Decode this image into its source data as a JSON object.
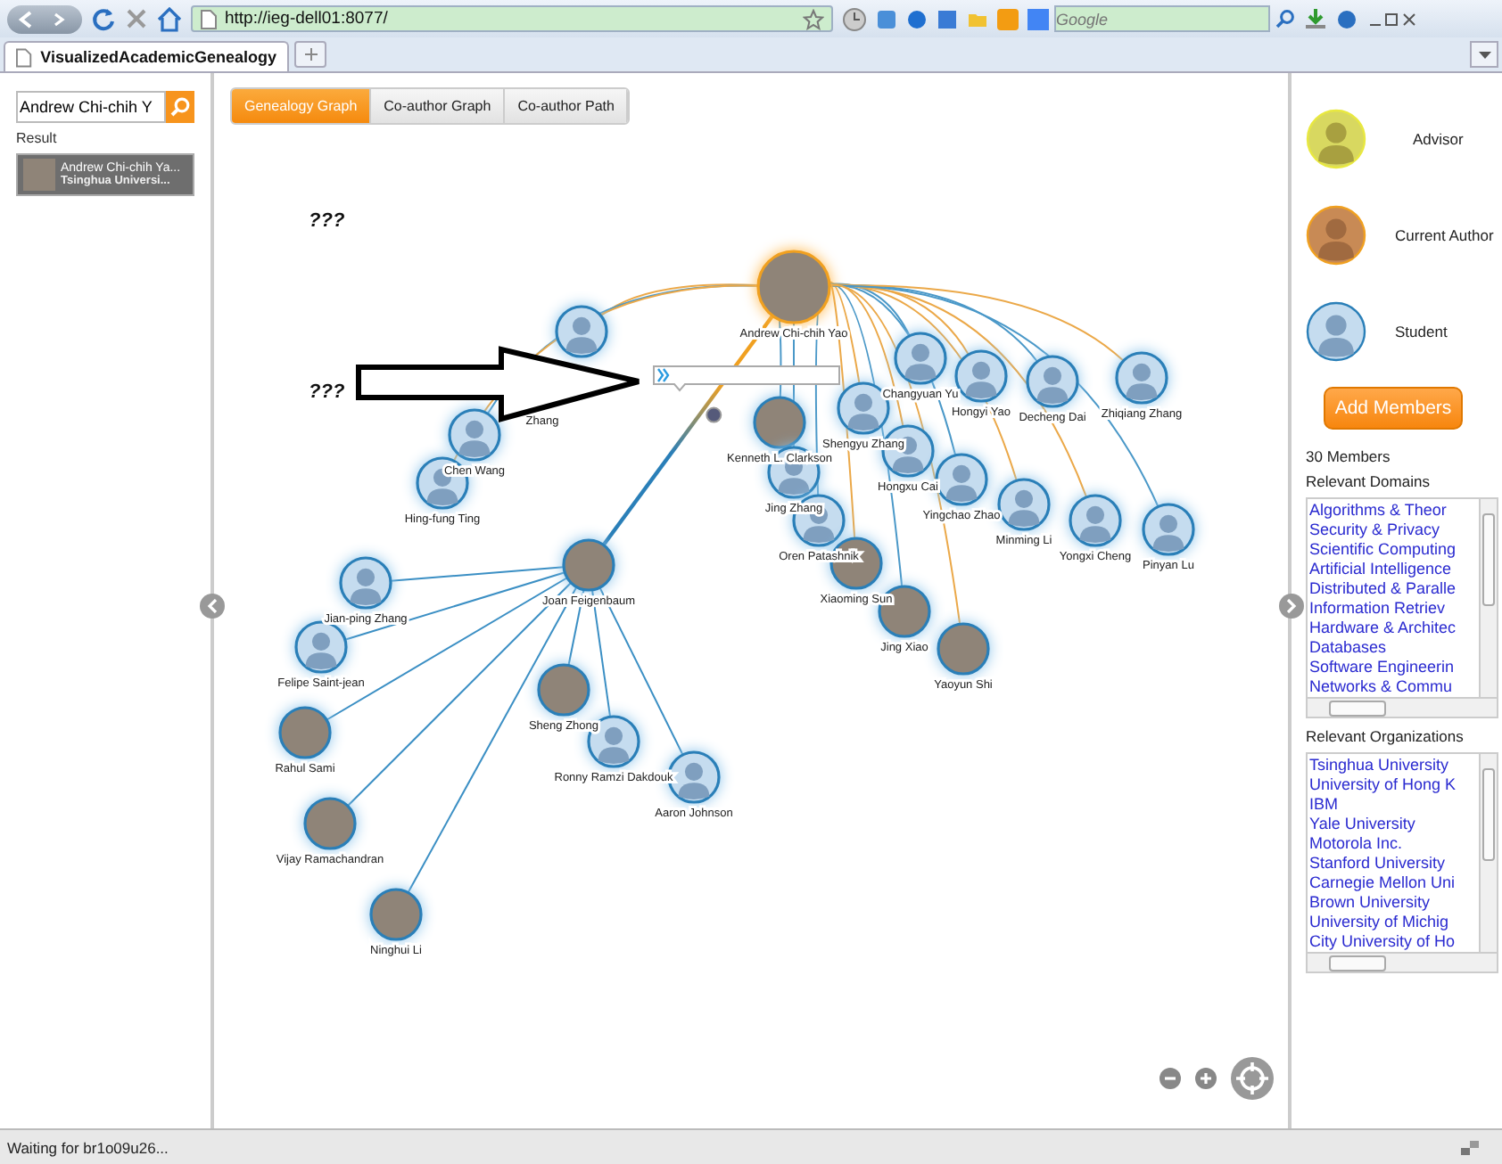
{
  "browser": {
    "url": "http://ieg-dell01:8077/",
    "search_placeholder": "Google",
    "tab_title": "VisualizedAcademicGenealogy"
  },
  "search": {
    "value": "Andrew Chi-chih Y",
    "result_label": "Result",
    "results": [
      {
        "name": "Andrew Chi-chih Ya...",
        "affiliation": "Tsinghua Universi...",
        "selected": true
      }
    ]
  },
  "view_tabs": [
    {
      "label": "Genealogy Graph",
      "selected": true
    },
    {
      "label": "Co-author Graph",
      "selected": false
    },
    {
      "label": "Co-author Path",
      "selected": false
    }
  ],
  "graph": {
    "annotations": [
      "???",
      "???"
    ],
    "nodes": [
      {
        "name": "Andrew Chi-chih Yao",
        "photo": true,
        "kind": "current"
      },
      {
        "name": "Zhang",
        "photo": false,
        "kind": "student"
      },
      {
        "name": "Chen Wang",
        "photo": false,
        "kind": "student"
      },
      {
        "name": "Hing-fung Ting",
        "photo": false,
        "kind": "student"
      },
      {
        "name": "Kenneth L. Clarkson",
        "photo": true,
        "kind": "student"
      },
      {
        "name": "Shengyu Zhang",
        "photo": false,
        "kind": "student"
      },
      {
        "name": "Changyuan Yu",
        "photo": false,
        "kind": "student"
      },
      {
        "name": "Hongyi Yao",
        "photo": false,
        "kind": "student"
      },
      {
        "name": "Decheng Dai",
        "photo": false,
        "kind": "student"
      },
      {
        "name": "Zhiqiang Zhang",
        "photo": false,
        "kind": "student"
      },
      {
        "name": "Jing Zhang",
        "photo": false,
        "kind": "student"
      },
      {
        "name": "Hongxu Cai",
        "photo": false,
        "kind": "student"
      },
      {
        "name": "Yingchao Zhao",
        "photo": false,
        "kind": "student"
      },
      {
        "name": "Minming Li",
        "photo": false,
        "kind": "student"
      },
      {
        "name": "Oren Patashnik",
        "photo": false,
        "kind": "student"
      },
      {
        "name": "Yongxi Cheng",
        "photo": false,
        "kind": "student"
      },
      {
        "name": "Pinyan Lu",
        "photo": false,
        "kind": "student"
      },
      {
        "name": "Xiaoming Sun",
        "photo": true,
        "kind": "student"
      },
      {
        "name": "Jing Xiao",
        "photo": true,
        "kind": "student"
      },
      {
        "name": "Yaoyun Shi",
        "photo": true,
        "kind": "student"
      },
      {
        "name": "Joan Feigenbaum",
        "photo": true,
        "kind": "student"
      },
      {
        "name": "Jian-ping Zhang",
        "photo": false,
        "kind": "student"
      },
      {
        "name": "Felipe Saint-jean",
        "photo": false,
        "kind": "student"
      },
      {
        "name": "Rahul Sami",
        "photo": true,
        "kind": "student"
      },
      {
        "name": "Vijay Ramachandran",
        "photo": true,
        "kind": "student"
      },
      {
        "name": "Ninghui Li",
        "photo": true,
        "kind": "student"
      },
      {
        "name": "Sheng Zhong",
        "photo": true,
        "kind": "student"
      },
      {
        "name": "Ronny Ramzi Dakdouk",
        "photo": false,
        "kind": "student"
      },
      {
        "name": "Aaron Johnson",
        "photo": false,
        "kind": "student"
      }
    ]
  },
  "legend": [
    {
      "label": "Advisor",
      "kind": "advisor"
    },
    {
      "label": "Current Author",
      "kind": "current"
    },
    {
      "label": "Student",
      "kind": "student"
    }
  ],
  "add_button": "Add Members",
  "member_count": "30 Members",
  "domains": {
    "title": "Relevant Domains",
    "items": [
      "Algorithms & Theor",
      "Security & Privacy",
      "Scientific Computing",
      "Artificial Intelligence",
      "Distributed & Paralle",
      "Information Retriev",
      "Hardware & Architec",
      "Databases",
      "Software Engineerin",
      "Networks & Commu"
    ]
  },
  "organizations": {
    "title": "Relevant Organizations",
    "items": [
      "Tsinghua University",
      "University of Hong K",
      "IBM",
      "Yale University",
      "Motorola Inc.",
      "Stanford University",
      "Carnegie Mellon Uni",
      "Brown University",
      "University of Michig",
      "City University of Ho"
    ]
  },
  "status": "Waiting for br1o09u26..."
}
